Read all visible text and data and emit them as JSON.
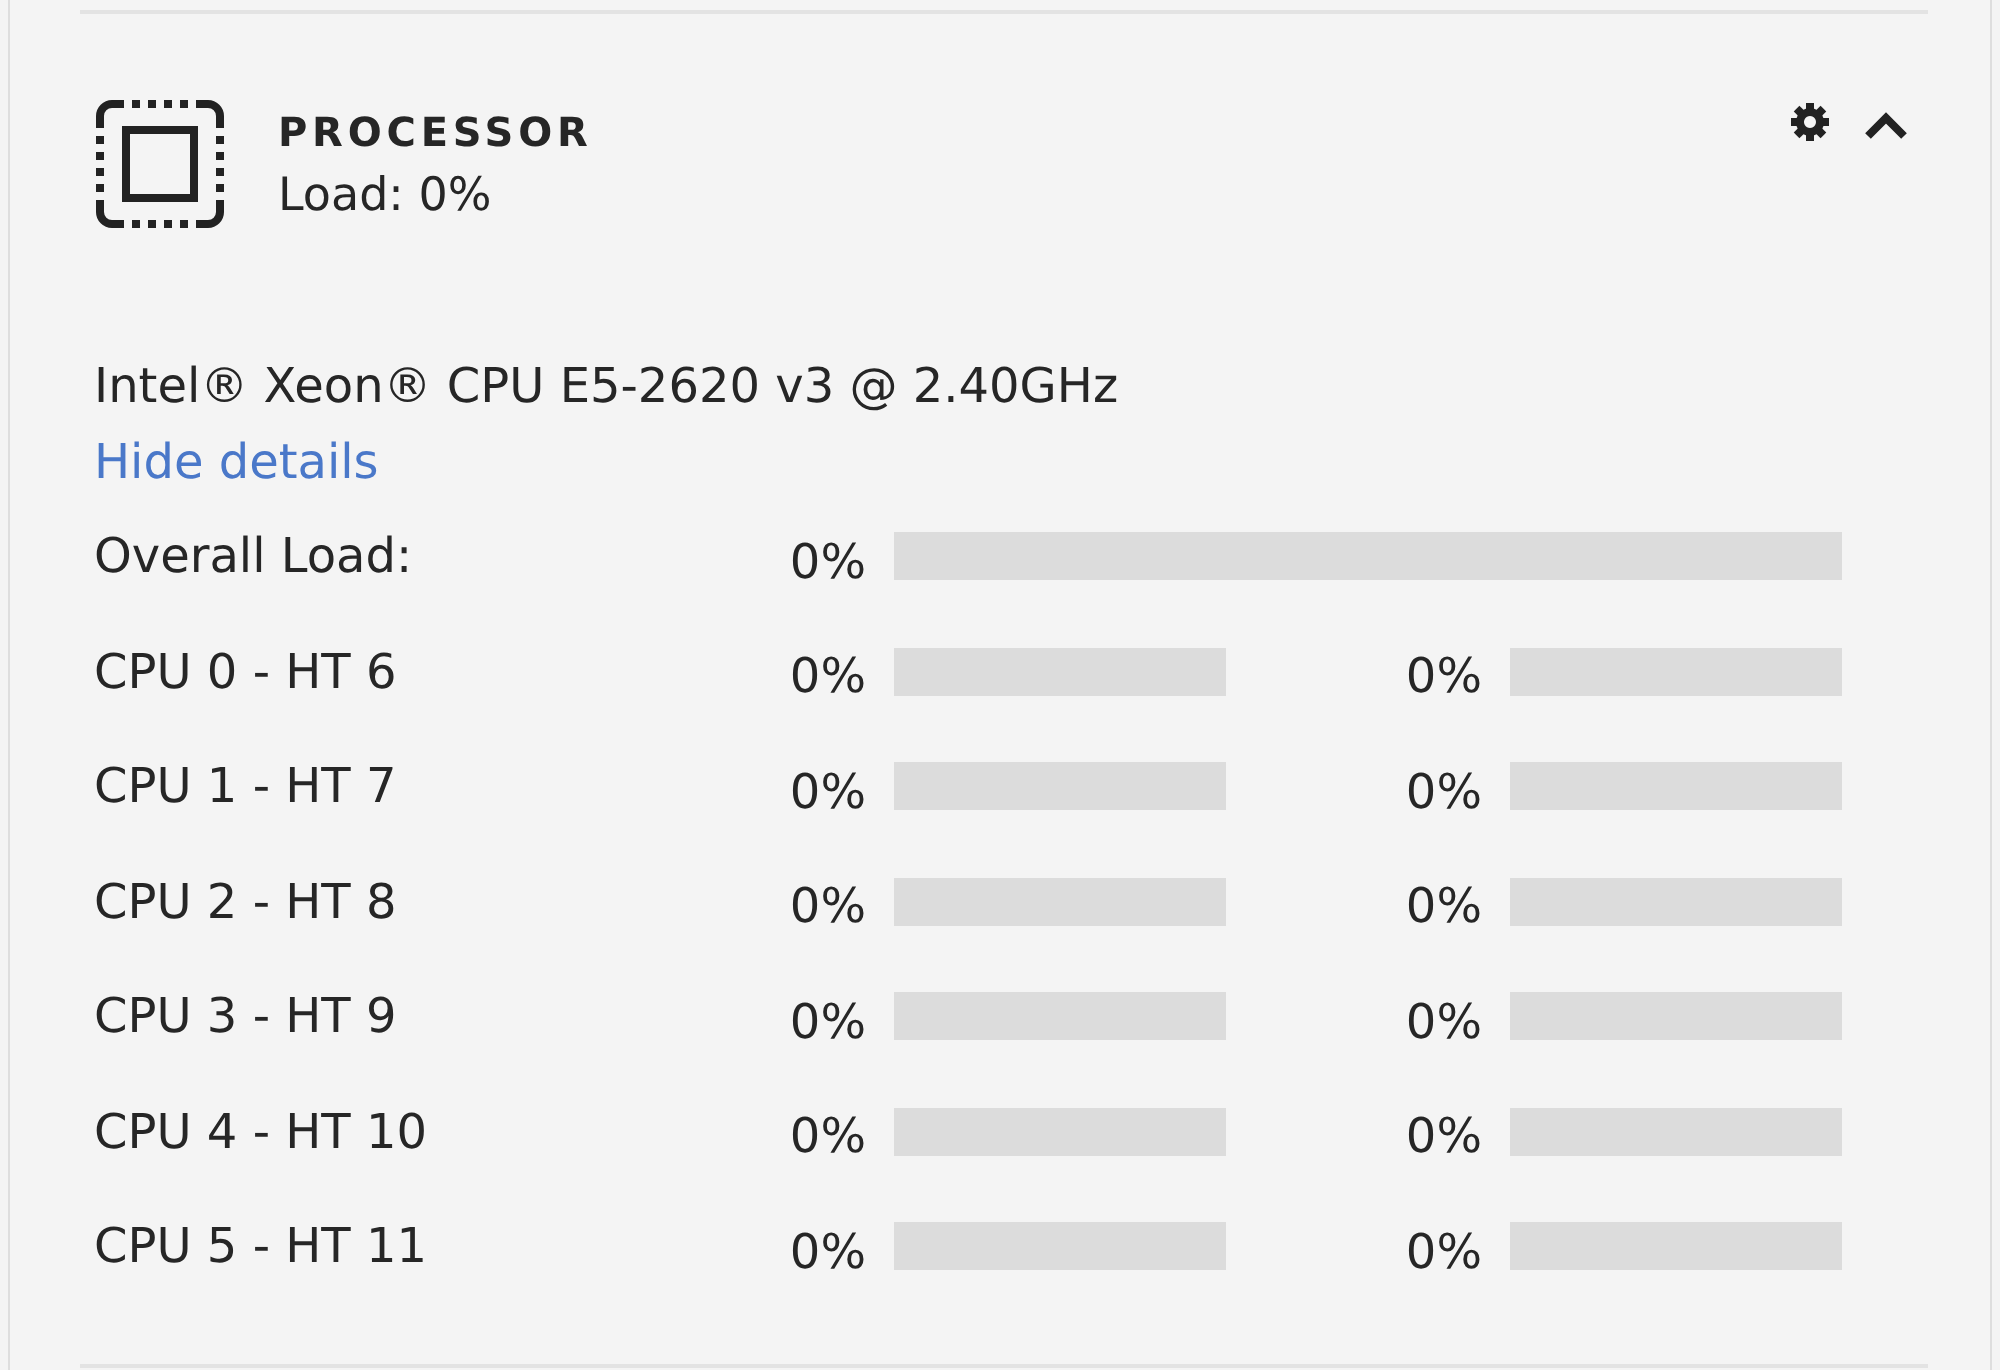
{
  "panel": {
    "title": "PROCESSOR",
    "subtitle": "Load: 0%",
    "expanded": true
  },
  "details": {
    "model": "Intel® Xeon® CPU E5-2620 v3 @ 2.40GHz",
    "toggle_link": "Hide details"
  },
  "overall": {
    "label": "Overall Load:",
    "reading": "0%",
    "level": 0
  },
  "cpus": [
    {
      "label": "CPU 0 - HT 6",
      "threads": [
        {
          "reading": "0%",
          "level": 0
        },
        {
          "reading": "0%",
          "level": 0
        }
      ]
    },
    {
      "label": "CPU 1 - HT 7",
      "threads": [
        {
          "reading": "0%",
          "level": 0
        },
        {
          "reading": "0%",
          "level": 0
        }
      ]
    },
    {
      "label": "CPU 2 - HT 8",
      "threads": [
        {
          "reading": "0%",
          "level": 0
        },
        {
          "reading": "0%",
          "level": 0
        }
      ]
    },
    {
      "label": "CPU 3 - HT 9",
      "threads": [
        {
          "reading": "0%",
          "level": 0
        },
        {
          "reading": "0%",
          "level": 0
        }
      ]
    },
    {
      "label": "CPU 4 - HT 10",
      "threads": [
        {
          "reading": "0%",
          "level": 0
        },
        {
          "reading": "0%",
          "level": 0
        }
      ]
    },
    {
      "label": "CPU 5 - HT 11",
      "threads": [
        {
          "reading": "0%",
          "level": 0
        },
        {
          "reading": "0%",
          "level": 0
        }
      ]
    }
  ]
}
